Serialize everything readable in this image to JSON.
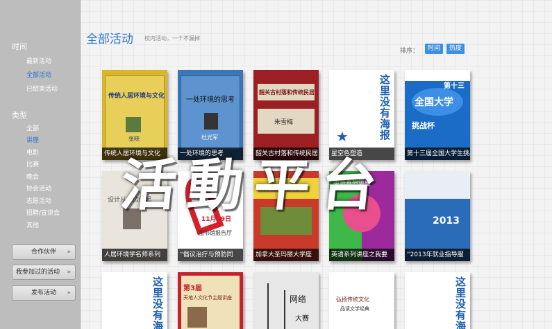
{
  "sidebar": {
    "time_heading": "时间",
    "time_items": [
      {
        "label": "最新活动",
        "active": false
      },
      {
        "label": "全部活动",
        "active": true
      },
      {
        "label": "已结束活动",
        "active": false
      }
    ],
    "type_heading": "类型",
    "type_items": [
      {
        "label": "全部",
        "active": false
      },
      {
        "label": "讲座",
        "active": true
      },
      {
        "label": "电影",
        "active": false
      },
      {
        "label": "比赛",
        "active": false
      },
      {
        "label": "晚会",
        "active": false
      },
      {
        "label": "协会活动",
        "active": false
      },
      {
        "label": "志愿活动",
        "active": false
      },
      {
        "label": "招聘/宣讲会",
        "active": false
      },
      {
        "label": "其他",
        "active": false
      }
    ],
    "buttons": {
      "partners": "合作伙伴",
      "my_activities": "我参加过的活动",
      "publish": "发布活动",
      "chevron": "»"
    }
  },
  "header": {
    "title": "全部活动",
    "subtitle": "校内活动，一个不漏掉",
    "sort_label": "排序：",
    "sort_time": "时间",
    "sort_hot": "热度"
  },
  "cards_row1": [
    {
      "caption": "传统人居环境与文化",
      "poster_title": "传统人居环境与文化",
      "poster_name": "张晓",
      "bg": "#d9b52c"
    },
    {
      "caption": "一处环境的思考",
      "poster_title": "一处环境的思考",
      "poster_name": "杜光军",
      "bg": "#3b77b8"
    },
    {
      "caption": "韶关古村落和传统民居",
      "poster_title": "韶关古村落和传统民居",
      "poster_name": "朱雪梅",
      "bg": "#9c1f24"
    },
    {
      "caption": "星空色塑造",
      "placeholder": "这里没有海报",
      "bg": "#ffffff"
    },
    {
      "caption": "第十三届全国大学生挑战杯",
      "poster_title": "全国大学",
      "poster_sub": "挑战杯",
      "poster_num": "第十三",
      "bg": "#1b6cc6"
    }
  ],
  "cards_row2": [
    {
      "caption": "人居环境学名师系列",
      "poster_title": "设计从身边做起",
      "bg": "#e9e4dc"
    },
    {
      "caption": "“倡议治疗与预防同",
      "poster_title": "11月29日",
      "poster_sub": "图书馆报告厅",
      "bg": "#ffffff"
    },
    {
      "caption": "加拿大圣玛丽大学座",
      "poster_title": "加拿大圣玛丽大学",
      "bg": "#c93a2a"
    },
    {
      "caption": "英语系列讲座之我要",
      "poster_title": "英语系列讲座",
      "bg": "#9c2a9c"
    },
    {
      "caption": "“2013年就业指导服",
      "poster_title": "2013",
      "bg": "#2a6cb8"
    }
  ],
  "cards_row3": [
    {
      "placeholder": "这里没有海",
      "bg": "#ffffff"
    },
    {
      "poster_title": "天地人文化节主题讲座",
      "poster_num": "第3届",
      "bg": "#f0e2b8"
    },
    {
      "poster_title": "网络",
      "poster_sub": "大赛",
      "bg": "#e7e7e7"
    },
    {
      "poster_title": "弘扬传统文化",
      "poster_sub": "品读文学经典",
      "bg": "#ffffff"
    },
    {
      "placeholder": "这里没有海",
      "bg": "#ffffff"
    }
  ],
  "watermark": "活動平台",
  "colors": {
    "accent": "#2c78d8",
    "sidebar_bg": "#bdbdbd",
    "sort_btn": "#3d8fe0"
  }
}
